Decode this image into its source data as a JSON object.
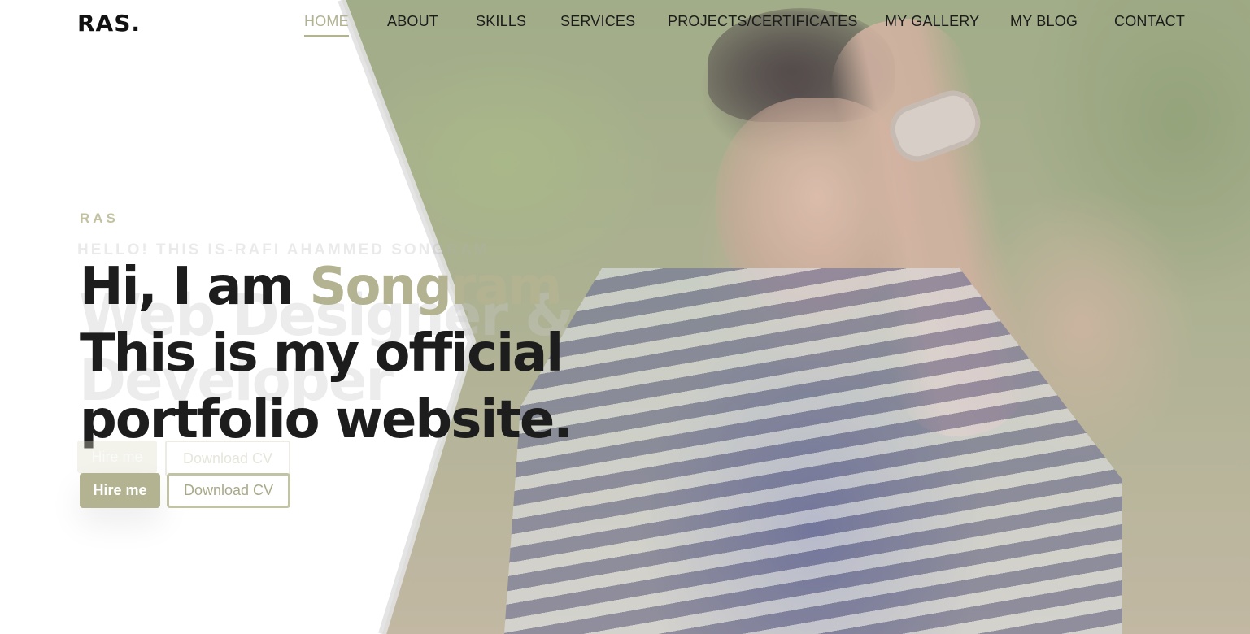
{
  "brand": {
    "logo": "RAS."
  },
  "nav": {
    "items": [
      {
        "label": "HOME",
        "active": true
      },
      {
        "label": "ABOUT"
      },
      {
        "label": "SKILLS"
      },
      {
        "label": "SERVICES"
      },
      {
        "label": "PROJECTS/CERTIFICATES"
      },
      {
        "label": "MY GALLERY"
      },
      {
        "label": "MY BLOG"
      },
      {
        "label": "CONTACT"
      }
    ]
  },
  "hero": {
    "kicker": "RAS",
    "ghost_subtitle": "HELLO! THIS IS-RAFI AHAMMED SONGRAM",
    "ghost_title_line1": "Web Designer &",
    "ghost_title_line2": "Developer",
    "headline_part1": "Hi, I am ",
    "headline_name": "Songram",
    "headline_line2": "This is my official",
    "headline_line3": "portfolio website.",
    "ghost_hire": "Hire me",
    "ghost_cv": "Download CV",
    "hire_button": "Hire me",
    "cv_button": "Download CV"
  },
  "colors": {
    "accent": "#b3b391",
    "text": "#1d1d1d"
  }
}
